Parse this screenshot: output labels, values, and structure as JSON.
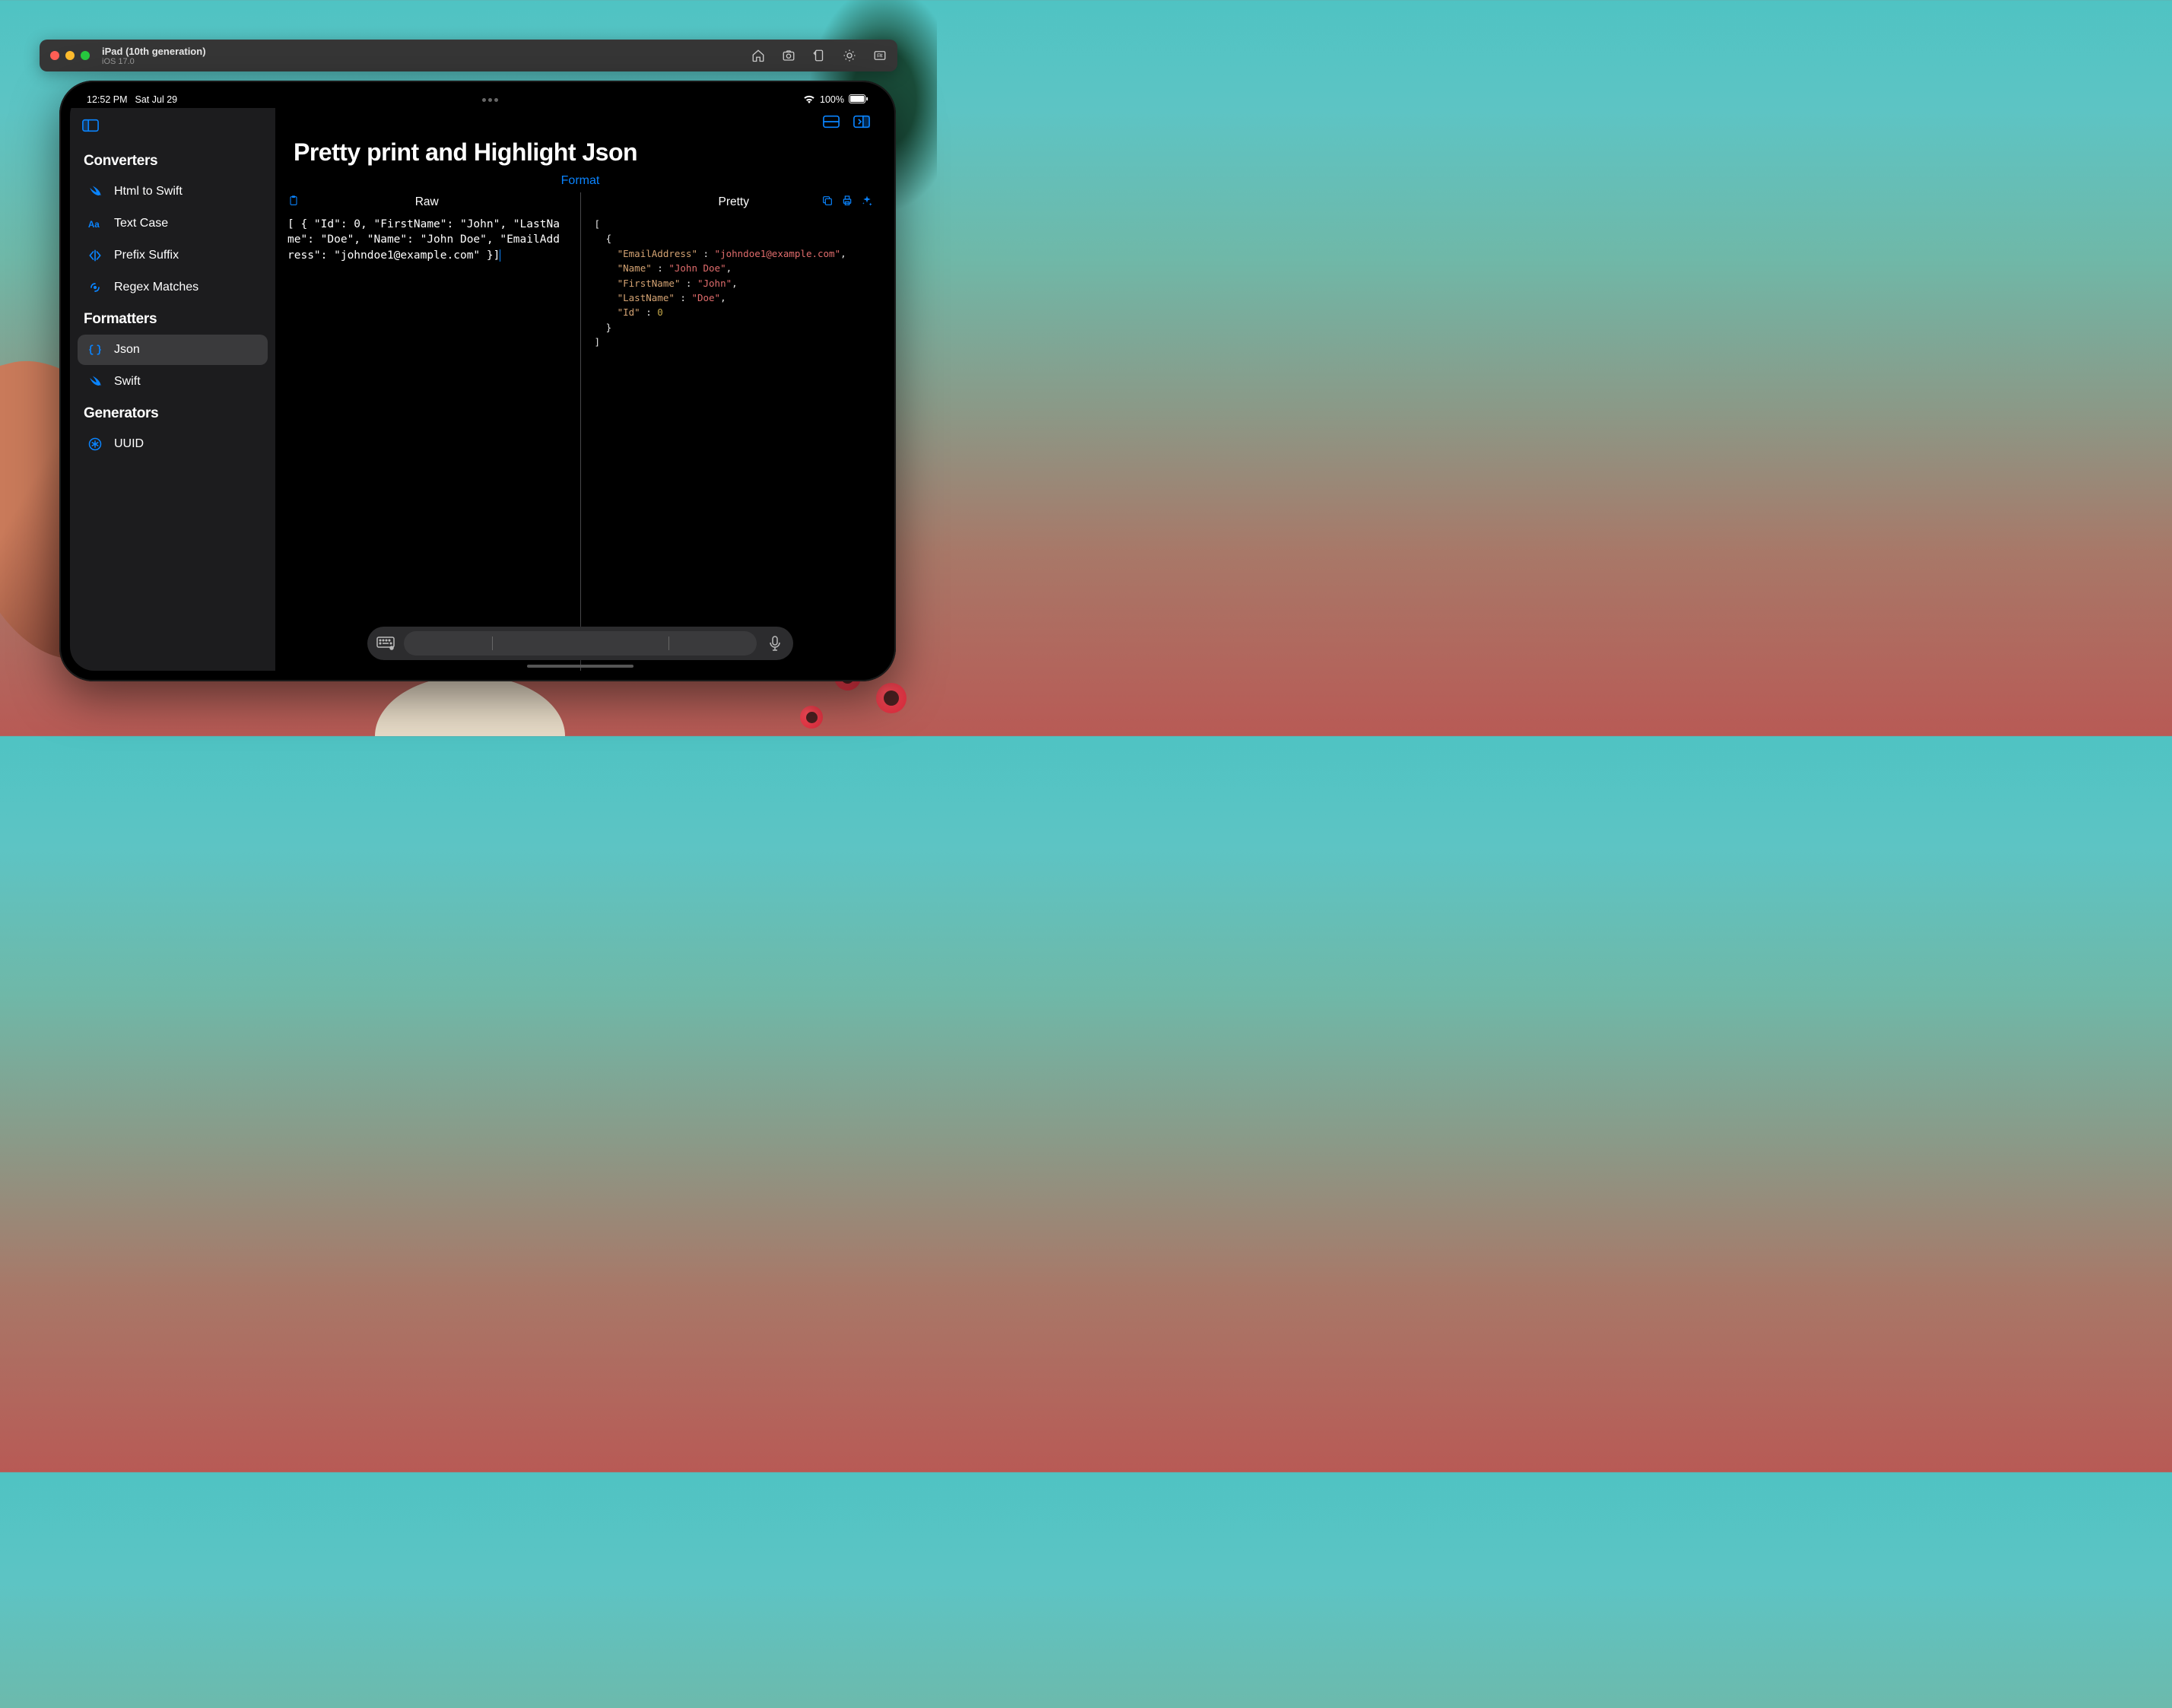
{
  "simulator": {
    "device": "iPad (10th generation)",
    "os": "iOS 17.0"
  },
  "status": {
    "time": "12:52 PM",
    "date": "Sat Jul 29",
    "battery": "100%"
  },
  "sidebar": {
    "sections": [
      {
        "title": "Converters",
        "items": [
          {
            "label": "Html to Swift"
          },
          {
            "label": "Text Case"
          },
          {
            "label": "Prefix Suffix"
          },
          {
            "label": "Regex Matches"
          }
        ]
      },
      {
        "title": "Formatters",
        "items": [
          {
            "label": "Json"
          },
          {
            "label": "Swift"
          }
        ]
      },
      {
        "title": "Generators",
        "items": [
          {
            "label": "UUID"
          }
        ]
      }
    ]
  },
  "main": {
    "title": "Pretty print and Highlight Json",
    "format_button": "Format",
    "raw_label": "Raw",
    "pretty_label": "Pretty",
    "raw_content": "[ { \"Id\": 0, \"FirstName\": \"John\", \"LastName\": \"Doe\", \"Name\": \"John Doe\", \"EmailAddress\": \"johndoe1@example.com\" }]",
    "pretty_tokens": [
      {
        "t": "punc",
        "v": "["
      },
      {
        "t": "nl"
      },
      {
        "t": "indent",
        "n": 1
      },
      {
        "t": "punc",
        "v": "{"
      },
      {
        "t": "nl"
      },
      {
        "t": "indent",
        "n": 2
      },
      {
        "t": "key",
        "v": "\"EmailAddress\""
      },
      {
        "t": "punc",
        "v": " : "
      },
      {
        "t": "str",
        "v": "\"johndoe1@example.com\""
      },
      {
        "t": "punc",
        "v": ","
      },
      {
        "t": "nl"
      },
      {
        "t": "indent",
        "n": 2
      },
      {
        "t": "key",
        "v": "\"Name\""
      },
      {
        "t": "punc",
        "v": " : "
      },
      {
        "t": "str",
        "v": "\"John Doe\""
      },
      {
        "t": "punc",
        "v": ","
      },
      {
        "t": "nl"
      },
      {
        "t": "indent",
        "n": 2
      },
      {
        "t": "key",
        "v": "\"FirstName\""
      },
      {
        "t": "punc",
        "v": " : "
      },
      {
        "t": "str",
        "v": "\"John\""
      },
      {
        "t": "punc",
        "v": ","
      },
      {
        "t": "nl"
      },
      {
        "t": "indent",
        "n": 2
      },
      {
        "t": "key",
        "v": "\"LastName\""
      },
      {
        "t": "punc",
        "v": " : "
      },
      {
        "t": "str",
        "v": "\"Doe\""
      },
      {
        "t": "punc",
        "v": ","
      },
      {
        "t": "nl"
      },
      {
        "t": "indent",
        "n": 2
      },
      {
        "t": "key",
        "v": "\"Id\""
      },
      {
        "t": "punc",
        "v": " : "
      },
      {
        "t": "num",
        "v": "0"
      },
      {
        "t": "nl"
      },
      {
        "t": "indent",
        "n": 1
      },
      {
        "t": "punc",
        "v": "}"
      },
      {
        "t": "nl"
      },
      {
        "t": "punc",
        "v": "]"
      }
    ]
  },
  "colors": {
    "accent": "#0a84ff"
  }
}
